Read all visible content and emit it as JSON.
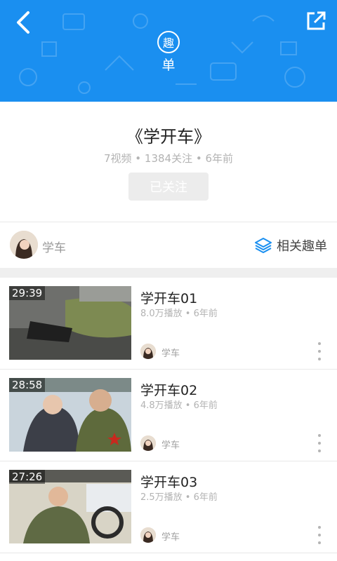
{
  "header": {
    "badge_char": "趣",
    "badge_label": "单"
  },
  "playlist": {
    "title": "《学开车》",
    "meta": "7视频 • 1384关注 • 6年前",
    "follow_label": "已关注"
  },
  "author": {
    "name": "学车",
    "related_label": "相关趣单"
  },
  "videos": [
    {
      "title": "学开车01",
      "meta": "8.0万播放 • 6年前",
      "duration": "29:39",
      "author": "学车"
    },
    {
      "title": "学开车02",
      "meta": "4.8万播放 • 6年前",
      "duration": "28:58",
      "author": "学车"
    },
    {
      "title": "学开车03",
      "meta": "2.5万播放 • 6年前",
      "duration": "27:26",
      "author": "学车"
    }
  ],
  "colors": {
    "header_bg": "#1a8ff0",
    "accent": "#1a8ff0"
  },
  "icons": {
    "back": "chevron-left-icon",
    "share": "external-link-icon",
    "related": "layers-icon",
    "more": "more-vertical-icon"
  }
}
